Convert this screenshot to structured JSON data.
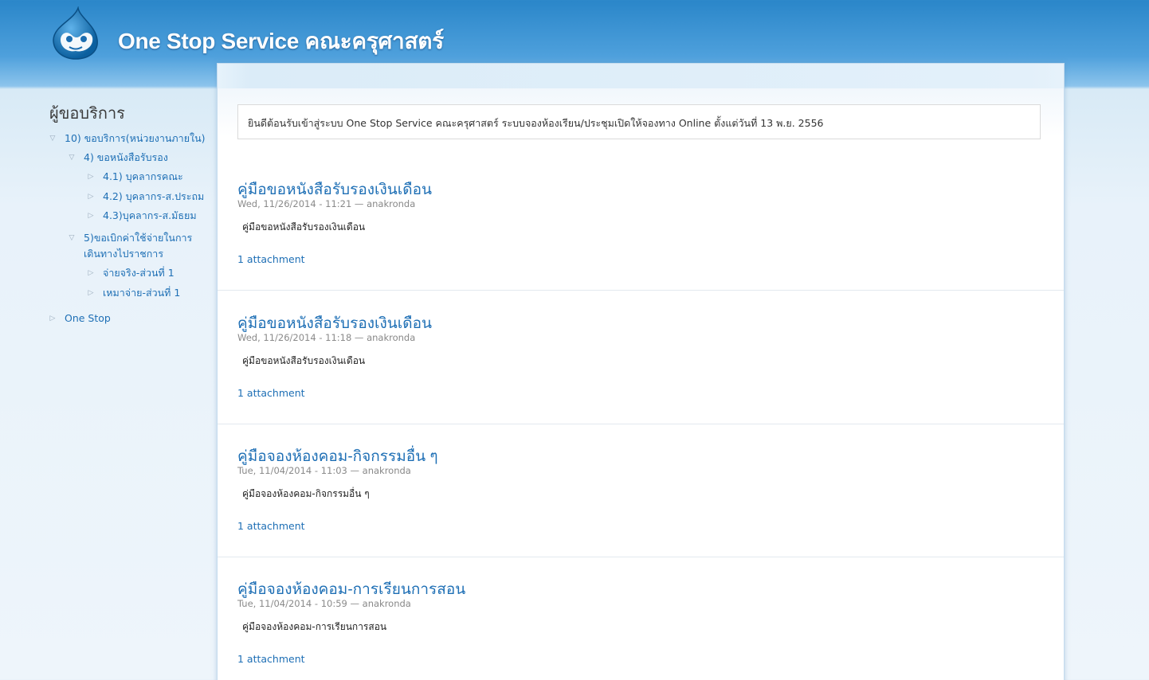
{
  "header": {
    "logo_icon": "drupal-drop-icon",
    "site_name": "One Stop Service คณะครุศาสตร์"
  },
  "sidebar": {
    "title": "ผู้ขอบริการ",
    "items": [
      {
        "label": "10) ขอบริการ(หน่วยงานภายใน)",
        "state": "expanded",
        "level": 0
      },
      {
        "label": "4) ขอหนังสือรับรอง",
        "state": "expanded",
        "level": 1
      },
      {
        "label": "4.1) บุคลากรคณะ",
        "state": "collapsed",
        "level": 2
      },
      {
        "label": "4.2) บุคลากร-ส.ประถม",
        "state": "collapsed",
        "level": 2
      },
      {
        "label": "4.3)บุคลากร-ส.มัธยม",
        "state": "collapsed",
        "level": 2
      },
      {
        "label": "5)ขอเบิกค่าใช้จ่ายในการเดินทางไปราชการ",
        "state": "expanded",
        "level": 1
      },
      {
        "label": "จ่ายจริง-ส่วนที่ 1",
        "state": "collapsed",
        "level": 2
      },
      {
        "label": "เหมาจ่าย-ส่วนที่ 1",
        "state": "collapsed",
        "level": 2
      },
      {
        "label": "One Stop",
        "state": "collapsed",
        "level": 0
      }
    ]
  },
  "main": {
    "welcome": "ยินดีต้อนรับเข้าสู่ระบบ One Stop Service คณะครุศาสตร์ ระบบจองห้องเรียน/ประชุมเปิดให้จองทาง Online ตั้งแต่วันที่ 13 พ.ย. 2556",
    "nodes": [
      {
        "title": "คู่มือขอหนังสือรับรองเงินเดือน",
        "date": "Wed, 11/26/2014 - 11:21",
        "author": "anakronda",
        "body": "คู่มือขอหนังสือรับรองเงินเดือน",
        "attachment": "1 attachment"
      },
      {
        "title": "คู่มือขอหนังสือรับรองเงินเดือน",
        "date": "Wed, 11/26/2014 - 11:18",
        "author": "anakronda",
        "body": "คู่มือขอหนังสือรับรองเงินเดือน",
        "attachment": "1 attachment"
      },
      {
        "title": "คู่มือจองห้องคอม-กิจกรรมอื่น ๆ",
        "date": "Tue, 11/04/2014 - 11:03",
        "author": "anakronda",
        "body": "คู่มือจองห้องคอม-กิจกรรมอื่น ๆ",
        "attachment": "1 attachment"
      },
      {
        "title": "คู่มือจองห้องคอม-การเรียนการสอน",
        "date": "Tue, 11/04/2014 - 10:59",
        "author": "anakronda",
        "body": "คู่มือจองห้องคอม-การเรียนการสอน",
        "attachment": "1 attachment"
      }
    ]
  },
  "colors": {
    "header_blue": "#2a86c9",
    "link": "#1e6fb5",
    "page_bg": "#eef5fb"
  }
}
